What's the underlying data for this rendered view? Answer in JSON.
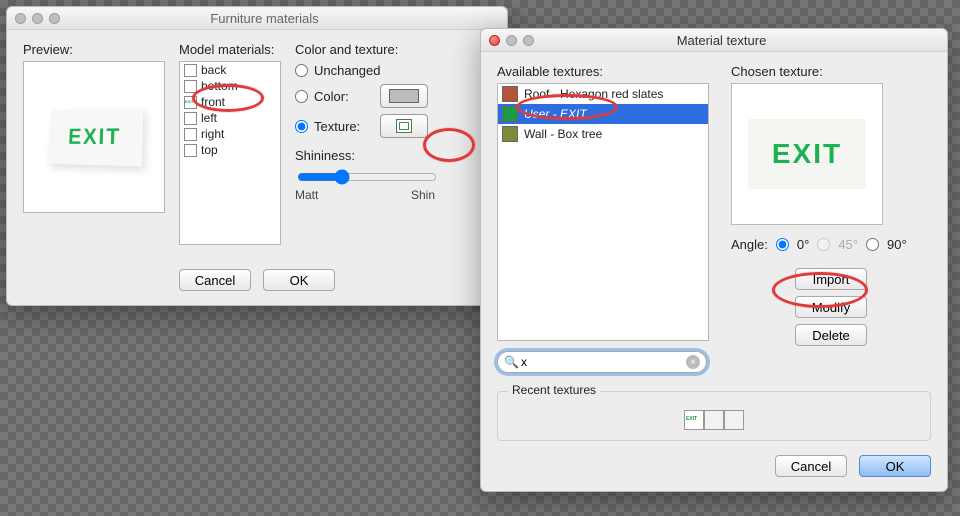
{
  "dialog1": {
    "title": "Furniture materials",
    "preview_label": "Preview:",
    "materials_label": "Model materials:",
    "materials": [
      "back",
      "bottom",
      "front",
      "left",
      "right",
      "top"
    ],
    "selected_material": "front",
    "color_texture_label": "Color and texture:",
    "opt_unchanged": "Unchanged",
    "opt_color": "Color:",
    "opt_texture": "Texture:",
    "shininess_label": "Shininess:",
    "shiny_min": "Matt",
    "shiny_max": "Shin",
    "cancel": "Cancel",
    "ok": "OK",
    "exit_text": "EXIT"
  },
  "dialog2": {
    "title": "Material texture",
    "available_label": "Available textures:",
    "textures": [
      {
        "name": "Roof - Hexagon red slates",
        "cls": "roof"
      },
      {
        "name": "User - EXIT",
        "cls": "user",
        "selected": true
      },
      {
        "name": "Wall - Box tree",
        "cls": "wall"
      }
    ],
    "chosen_label": "Chosen texture:",
    "exit_text": "EXIT",
    "angle_label": "Angle:",
    "angle0": "0°",
    "angle45": "45°",
    "angle90": "90°",
    "import": "Import",
    "modify": "Modify",
    "delete": "Delete",
    "search_value": "x",
    "recent_label": "Recent textures",
    "cancel": "Cancel",
    "ok": "OK"
  }
}
